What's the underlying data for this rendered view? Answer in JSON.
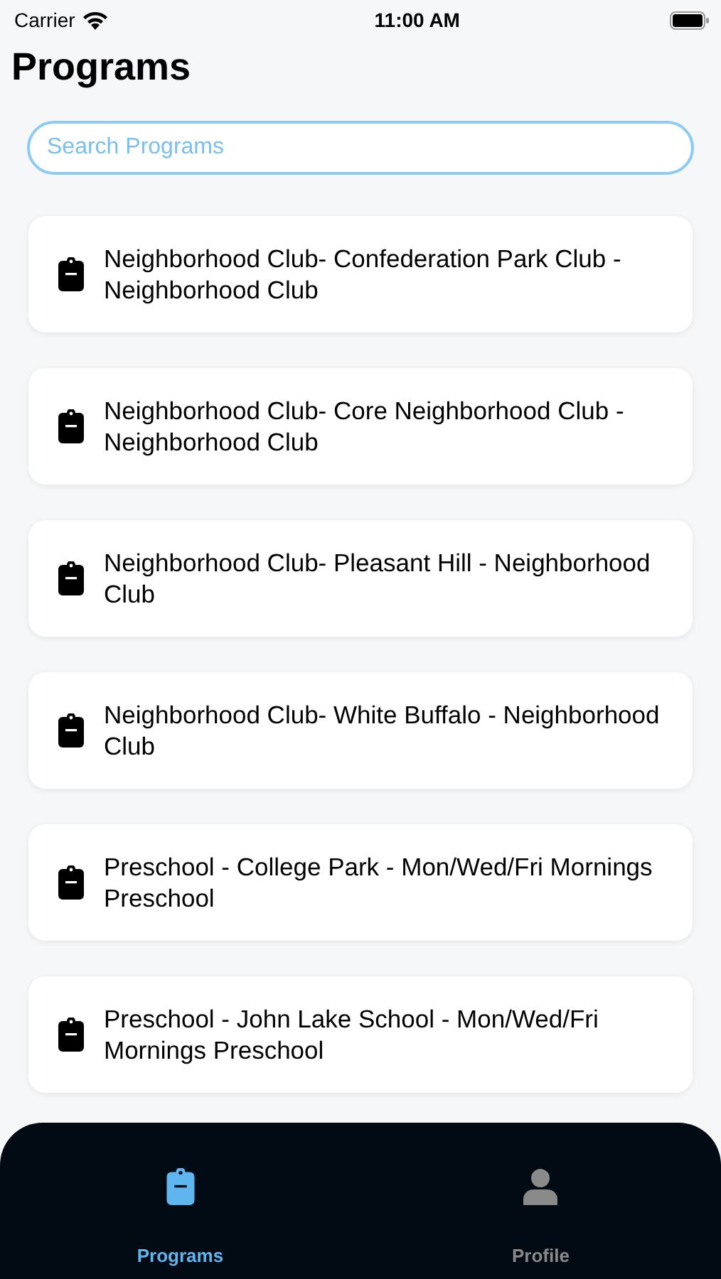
{
  "status_bar": {
    "carrier": "Carrier",
    "time": "11:00 AM"
  },
  "title": "Programs",
  "search": {
    "placeholder": "Search Programs"
  },
  "programs": [
    {
      "name": "Neighborhood Club- Confederation Park Club - Neighborhood Club"
    },
    {
      "name": "Neighborhood Club- Core Neighborhood Club - Neighborhood Club"
    },
    {
      "name": "Neighborhood Club- Pleasant Hill  - Neighborhood Club"
    },
    {
      "name": "Neighborhood Club- White Buffalo  - Neighborhood Club"
    },
    {
      "name": "Preschool - College Park - Mon/Wed/Fri Mornings Preschool"
    },
    {
      "name": "Preschool - John Lake School - Mon/Wed/Fri Mornings Preschool"
    }
  ],
  "tabs": [
    {
      "label": "Programs",
      "kind": "clipboard",
      "selected": true
    },
    {
      "label": "Profile",
      "kind": "person",
      "selected": false
    }
  ]
}
